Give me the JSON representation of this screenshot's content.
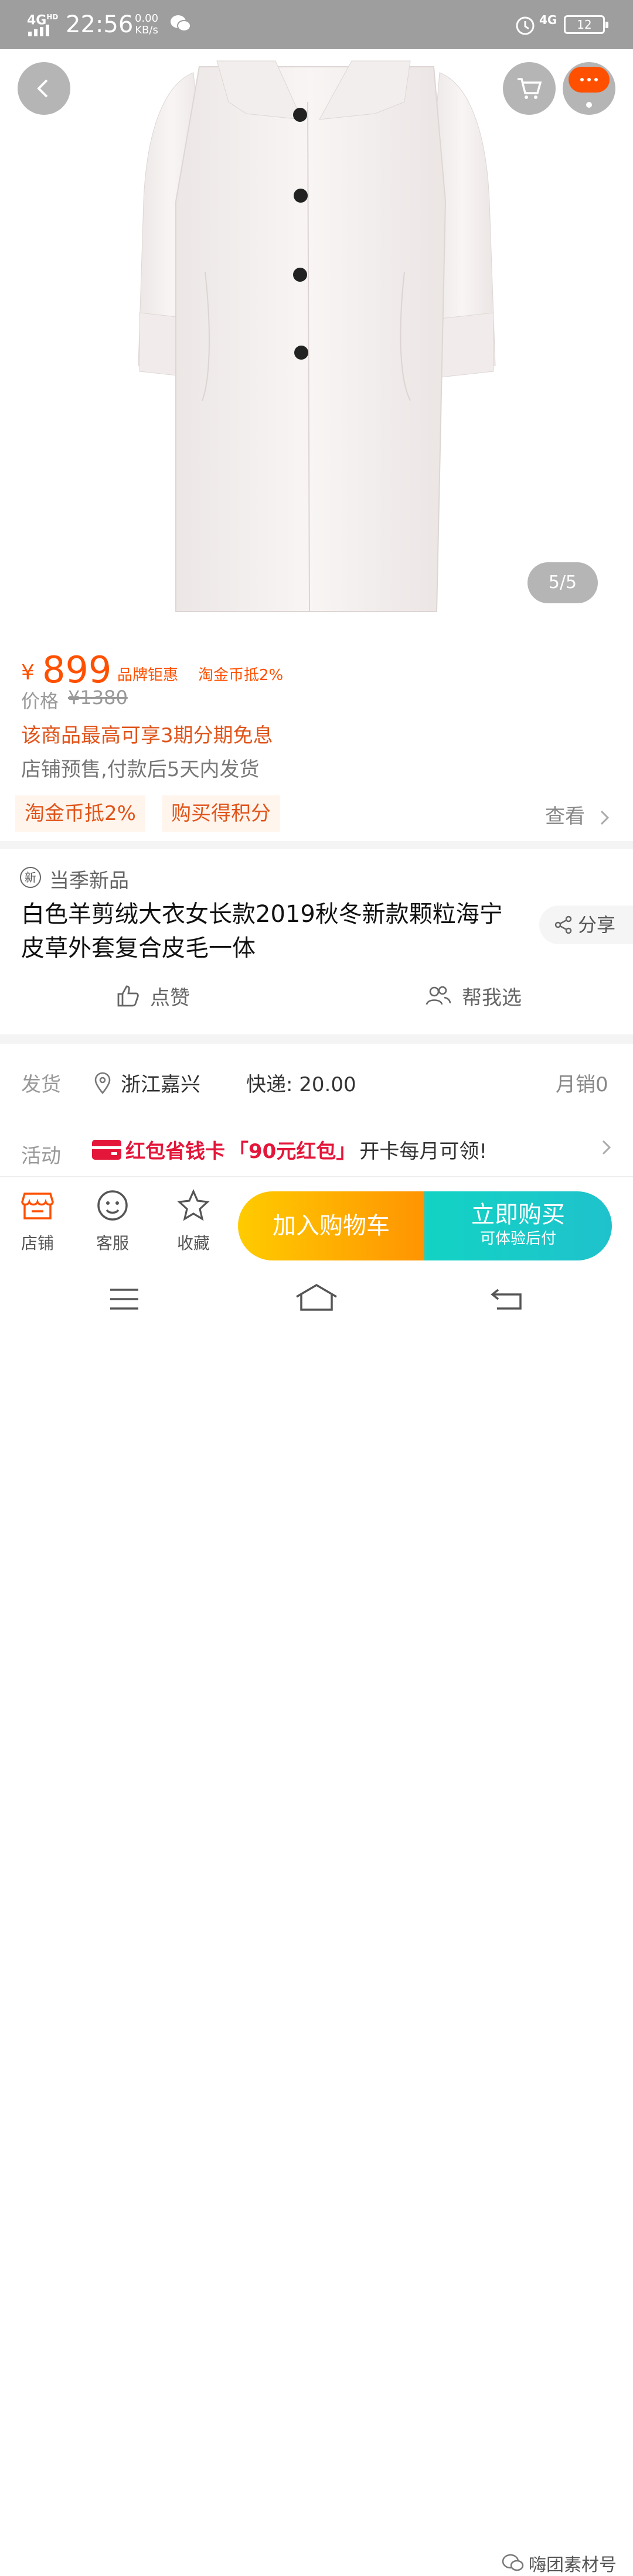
{
  "status": {
    "network": "4G",
    "network_sup": "HD",
    "time": "22:56",
    "speed_value": "0.00",
    "speed_unit": "KB/s",
    "signal2": "4G",
    "battery": "12"
  },
  "gallery": {
    "pager": "5/5"
  },
  "price": {
    "currency": "¥",
    "value": "899",
    "tag1": "品牌钜惠",
    "tag2": "淘金币抵2%",
    "original_label": "价格",
    "original_value": "¥1380",
    "installment": "该商品最高可享3期分期免息",
    "presale": "店铺预售,付款后5天内发货"
  },
  "promos": {
    "chip1": "淘金币抵2%",
    "chip2": "购买得积分",
    "view_more": "查看"
  },
  "product": {
    "new_icon": "新",
    "new_label": "当季新品",
    "title": "白色羊剪绒大衣女长款2019秋冬新款颗粒海宁皮草外套复合皮毛一体",
    "share": "分享",
    "like": "点赞",
    "help": "帮我选"
  },
  "shipping": {
    "label": "发货",
    "location": "浙江嘉兴",
    "fee": "快递: 20.00",
    "monthly": "月销0"
  },
  "activity": {
    "label": "活动",
    "card": "红包省钱卡",
    "bracket": "「90元红包」",
    "suffix": "开卡每月可领!"
  },
  "bottombar": {
    "shop": "店铺",
    "service": "客服",
    "favorite": "收藏",
    "add_cart": "加入购物车",
    "buy_now": "立即购买",
    "buy_sub": "可体验后付"
  },
  "watermark": "嗨团素材号",
  "colors": {
    "accent": "#ff5000",
    "cart_gradient": [
      "#ffcb00",
      "#ff9402"
    ],
    "buy_gradient": [
      "#12d3c4",
      "#1fc2cc"
    ]
  }
}
